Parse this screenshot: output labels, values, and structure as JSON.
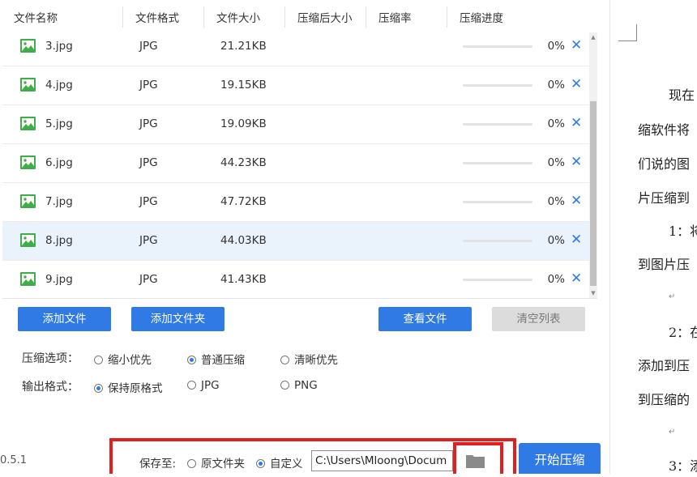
{
  "table": {
    "columns": [
      "文件名称",
      "文件格式",
      "文件大小",
      "压缩后大小",
      "压缩率",
      "压缩进度"
    ],
    "rows": [
      {
        "name": "3.jpg",
        "format": "JPG",
        "size": "21.21KB",
        "compressed_size": "",
        "ratio": "",
        "progress": 0,
        "progress_text": "0%",
        "selected": false
      },
      {
        "name": "4.jpg",
        "format": "JPG",
        "size": "19.15KB",
        "compressed_size": "",
        "ratio": "",
        "progress": 0,
        "progress_text": "0%",
        "selected": false
      },
      {
        "name": "5.jpg",
        "format": "JPG",
        "size": "19.09KB",
        "compressed_size": "",
        "ratio": "",
        "progress": 0,
        "progress_text": "0%",
        "selected": false
      },
      {
        "name": "6.jpg",
        "format": "JPG",
        "size": "44.23KB",
        "compressed_size": "",
        "ratio": "",
        "progress": 0,
        "progress_text": "0%",
        "selected": false
      },
      {
        "name": "7.jpg",
        "format": "JPG",
        "size": "47.72KB",
        "compressed_size": "",
        "ratio": "",
        "progress": 0,
        "progress_text": "0%",
        "selected": false
      },
      {
        "name": "8.jpg",
        "format": "JPG",
        "size": "44.03KB",
        "compressed_size": "",
        "ratio": "",
        "progress": 0,
        "progress_text": "0%",
        "selected": true
      },
      {
        "name": "9.jpg",
        "format": "JPG",
        "size": "41.43KB",
        "compressed_size": "",
        "ratio": "",
        "progress": 0,
        "progress_text": "0%",
        "selected": false
      }
    ],
    "file_icon": "image-file-icon",
    "delete_icon": "close-icon"
  },
  "buttons": {
    "add_file": "添加文件",
    "add_folder": "添加文件夹",
    "view_files": "查看文件",
    "clear_list": "清空列表",
    "start": "开始压缩"
  },
  "options": {
    "compress_label": "压缩选项：",
    "compress_choices": [
      {
        "label": "缩小优先",
        "selected": false
      },
      {
        "label": "普通压缩",
        "selected": true
      },
      {
        "label": "清晰优先",
        "selected": false
      }
    ],
    "format_label": "输出格式：",
    "format_choices": [
      {
        "label": "保持原格式",
        "selected": true
      },
      {
        "label": "JPG",
        "selected": false
      },
      {
        "label": "PNG",
        "selected": false
      }
    ]
  },
  "save": {
    "label": "保存至:",
    "original_folder": "原文件夹",
    "custom": "自定义",
    "original_selected": false,
    "custom_selected": true,
    "path": "C:\\Users\\Mloong\\Docum",
    "folder_icon": "folder-icon"
  },
  "version": "0.5.1",
  "document": {
    "lines": [
      "现在",
      "缩软件将",
      "们说的图",
      "片压缩到",
      "1：将",
      "到图片压",
      "2：在",
      "添加到压",
      "到压缩的",
      "3：添"
    ],
    "paragraph_mark": "↵"
  },
  "colors": {
    "accent": "#2f7ae5",
    "highlight_border": "#e02020",
    "selected_row": "#eaf2fc",
    "disabled_button": "#dcdcdc"
  }
}
